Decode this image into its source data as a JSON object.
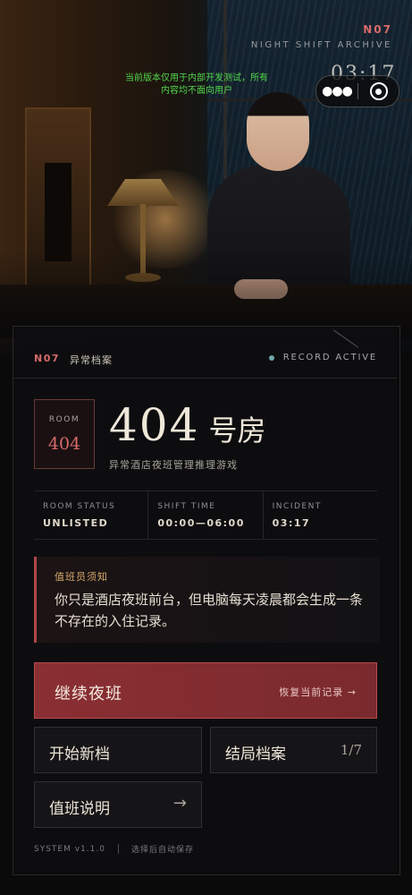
{
  "header": {
    "code": "N07",
    "archive": "NIGHT SHIFT ARCHIVE",
    "dev_notice": "当前版本仅用于内部开发测试，所有内容均不面向用户",
    "clock": "03:17"
  },
  "capsule": {
    "more_icon": "more-icon",
    "close_icon": "target-icon"
  },
  "card": {
    "code": "N07",
    "label": "异常档案",
    "status": "RECORD ACTIVE",
    "room_label": "ROOM",
    "room_number": "404",
    "room_title_number": "404",
    "room_title_unit": "号房",
    "subtitle": "异常酒店夜班管理推理游戏",
    "stats": [
      {
        "key": "ROOM STATUS",
        "value": "UNLISTED"
      },
      {
        "key": "SHIFT TIME",
        "value": "00:00—06:00"
      },
      {
        "key": "INCIDENT",
        "value": "03:17"
      }
    ],
    "notice": {
      "title": "值班员须知",
      "body": "你只是酒店夜班前台，但电脑每天凌晨都会生成一条不存在的入住记录。"
    }
  },
  "buttons": {
    "continue": {
      "label": "继续夜班",
      "hint": "恢复当前记录 →"
    },
    "new_game": {
      "label": "开始新档"
    },
    "endings": {
      "label": "结局档案",
      "count": "1/7"
    },
    "guide": {
      "label": "值班说明",
      "arrow": "→"
    }
  },
  "footer": {
    "version": "SYSTEM v1.1.0",
    "autosave": "选择后自动保存"
  },
  "colors": {
    "accent_red": "#d96a6a",
    "primary_button": "#8a2f33",
    "dev_notice_green": "#53d64c"
  }
}
